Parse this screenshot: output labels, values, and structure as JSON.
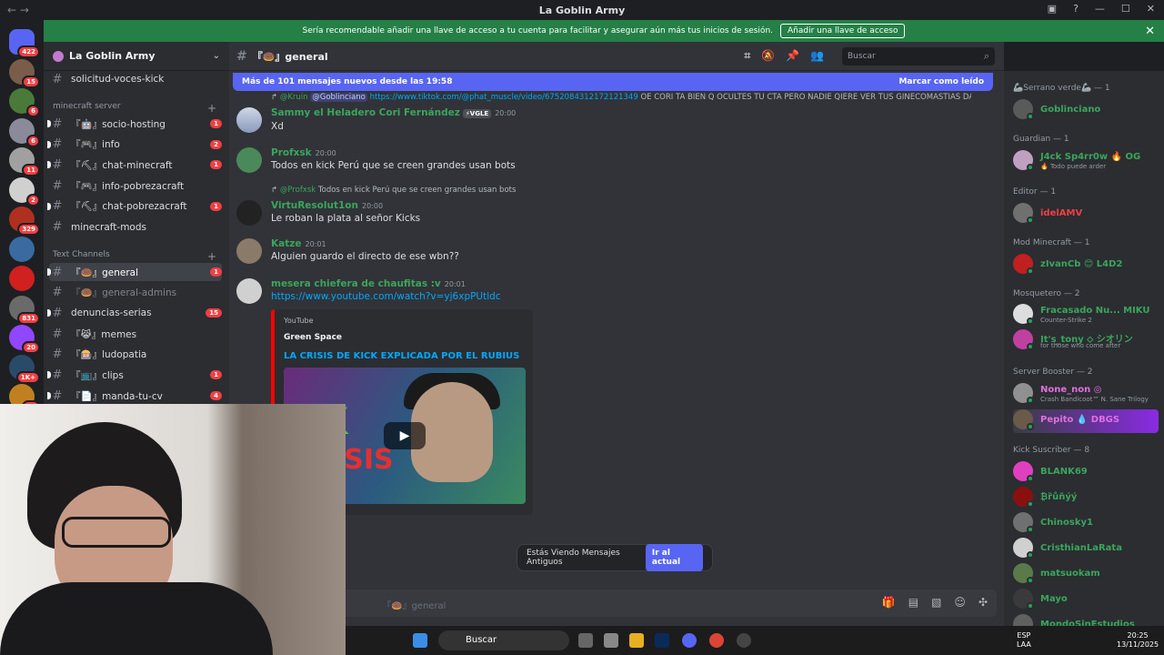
{
  "window": {
    "title": "La Goblin Army",
    "nav": "←  →"
  },
  "banner": {
    "text": "Sería recomendable añadir una llave de acceso a tu cuenta para facilitar y asegurar aún más tus inicios de sesión.",
    "button": "Añadir una llave de acceso",
    "close": "✕"
  },
  "servers": [
    {
      "badge": "422",
      "color": "#5865f2"
    },
    {
      "badge": "15",
      "color": "#7a5c4a"
    },
    {
      "badge": "6",
      "color": "#4a7a3a"
    },
    {
      "badge": "6",
      "color": "#8a8a9a"
    },
    {
      "badge": "11",
      "color": "#a0a0a0"
    },
    {
      "badge": "2",
      "color": "#d0d0d0"
    },
    {
      "badge": "329",
      "color": "#b03020"
    },
    {
      "badge": "",
      "color": "#3a6aa0"
    },
    {
      "badge": "",
      "color": "#d02020"
    },
    {
      "badge": "831",
      "color": "#6a6a6a"
    },
    {
      "badge": "20",
      "color": "#9146ff"
    },
    {
      "badge": "1K+",
      "color": "#2a4a6a"
    },
    {
      "badge": "98",
      "color": "#c08020"
    }
  ],
  "guild": {
    "name": "La Goblin Army"
  },
  "channels": {
    "top": [
      {
        "name": "solicitud-voces-kick",
        "badge": ""
      }
    ],
    "cat1": "minecraft server",
    "mc": [
      {
        "name": "『🤖』socio-hosting",
        "badge": "1"
      },
      {
        "name": "『🎮』info",
        "badge": "2"
      },
      {
        "name": "『⛏』chat-minecraft",
        "badge": "1"
      },
      {
        "name": "『🎮』info-pobrezacraft",
        "badge": ""
      },
      {
        "name": "『⛏』chat-pobrezacraft",
        "badge": "1"
      },
      {
        "name": "minecraft-mods",
        "badge": ""
      }
    ],
    "cat2": "Text Channels",
    "text": [
      {
        "name": "『🍩』general",
        "badge": "1"
      },
      {
        "name": "『🍩』general-admins",
        "badge": ""
      },
      {
        "name": "denuncias-serias",
        "badge": "15"
      },
      {
        "name": "『😹』memes",
        "badge": ""
      },
      {
        "name": "『🎰』ludopatia",
        "badge": ""
      },
      {
        "name": "『📺』clips",
        "badge": "1"
      },
      {
        "name": "『📄』manda-tu-cv",
        "badge": "4"
      }
    ]
  },
  "header": {
    "channel": "『🍩』general",
    "search_placeholder": "Buscar"
  },
  "newbar": {
    "text": "Más de 101 mensajes nuevos desde las 19:58",
    "mark": "Marcar como leído"
  },
  "messages": [
    {
      "reply_user": "@Kruin",
      "reply_mention": "@Goblinciano",
      "reply_link": "https://www.tiktok.com/@phat_muscle/video/6752084312172121349",
      "reply_text": "OE CORI TA BIEN Q OCULTES TU CTA PERO NADIE QIERE VER TUS GINECOMASTIAS DAAAA...",
      "user": "Sammy el Heladero Cori Fernández",
      "tag": "⚡VGLE",
      "time": "20:00",
      "text": "Xd"
    },
    {
      "user": "Profxsk",
      "time": "20:00",
      "text": "Todos en kick Perú que se creen grandes usan bots"
    },
    {
      "reply_user": "@Profxsk",
      "reply_text": "Todos en kick Perú que se creen grandes usan bots",
      "user": "VirtuResolut1on",
      "time": "20:00",
      "text": "Le roban la plata al señor Kicks"
    },
    {
      "user": "Katze",
      "time": "20:01",
      "text": "Alguien guardo el directo de ese wbn??"
    },
    {
      "user": "mesera chiefera de chaufitas :v",
      "time": "20:01",
      "text": "https://www.youtube.com/watch?v=yj6xpPUtldc"
    }
  ],
  "embed": {
    "provider": "YouTube",
    "author": "Green Space",
    "title": "LA CRISIS DE KICK EXPLICADA POR EL RUBIUS",
    "thumb_big": "CK",
    "thumb_red": "CRISIS"
  },
  "old_notice": {
    "text": "Estás Viendo Mensajes Antiguos",
    "button": "Ir al actual"
  },
  "composer": {
    "placeholder": "『🍩』general"
  },
  "members": {
    "roles": [
      {
        "name": "🦾Serrano verde🦾 — 1"
      },
      {
        "name": "Guardian — 1"
      },
      {
        "name": "Editor — 1"
      },
      {
        "name": "Mod Minecraft — 1"
      },
      {
        "name": "Mosquetero — 2"
      },
      {
        "name": "Server Booster — 2"
      },
      {
        "name": "Kick Suscriber — 8"
      }
    ],
    "list": [
      {
        "name": "Goblinciano",
        "status": "",
        "color": "#3ba55c",
        "av": "#5a5a5a"
      },
      {
        "name": "J4ck Sp4rr0w 🔥 OG",
        "status": "🔥 Todo puede arder",
        "color": "#3ba55c",
        "av": "#c0a0c0"
      },
      {
        "name": "idelAMV",
        "status": "",
        "color": "#f23f43",
        "av": "#707070"
      },
      {
        "name": "zIvanCb 😊 L4D2",
        "status": "",
        "color": "#3ba55c",
        "av": "#c02020"
      },
      {
        "name": "Fracasado Nu... MIKU",
        "status": "Counter-Strike 2",
        "color": "#3ba55c",
        "av": "#ddd"
      },
      {
        "name": "It's_tony ⬦ シオリン",
        "status": "for those who come after",
        "color": "#3ba55c",
        "av": "#c040a0"
      },
      {
        "name": "None_non ◎",
        "status": "Crash Bandicoot™ N. Sane Trilogy",
        "color": "#e070e0",
        "av": "#909090"
      },
      {
        "name": "Pepito 💧 DBGS",
        "status": "",
        "color": "#e070e0",
        "av": "#6a5a4a"
      },
      {
        "name": "BLANK69",
        "status": "",
        "color": "#3ba55c",
        "av": "#e040c0"
      },
      {
        "name": "₿ȑůňýý",
        "status": "",
        "color": "#3ba55c",
        "av": "#8a1010"
      },
      {
        "name": "Chinosky1",
        "status": "",
        "color": "#3ba55c",
        "av": "#707070"
      },
      {
        "name": "CristhianLaRata",
        "status": "",
        "color": "#3ba55c",
        "av": "#d0d0d0"
      },
      {
        "name": "matsuokam",
        "status": "",
        "color": "#3ba55c",
        "av": "#5a7a4a"
      },
      {
        "name": "Mayo",
        "status": "",
        "color": "#3ba55c",
        "av": "#3a3a3a"
      },
      {
        "name": "MondoSinEstudios",
        "status": "",
        "color": "#3ba55c",
        "av": "#606060"
      }
    ]
  },
  "taskbar": {
    "search": "Buscar",
    "lang": "ESP",
    "lang2": "LAA",
    "time": "20:25",
    "date": "13/11/2025"
  }
}
